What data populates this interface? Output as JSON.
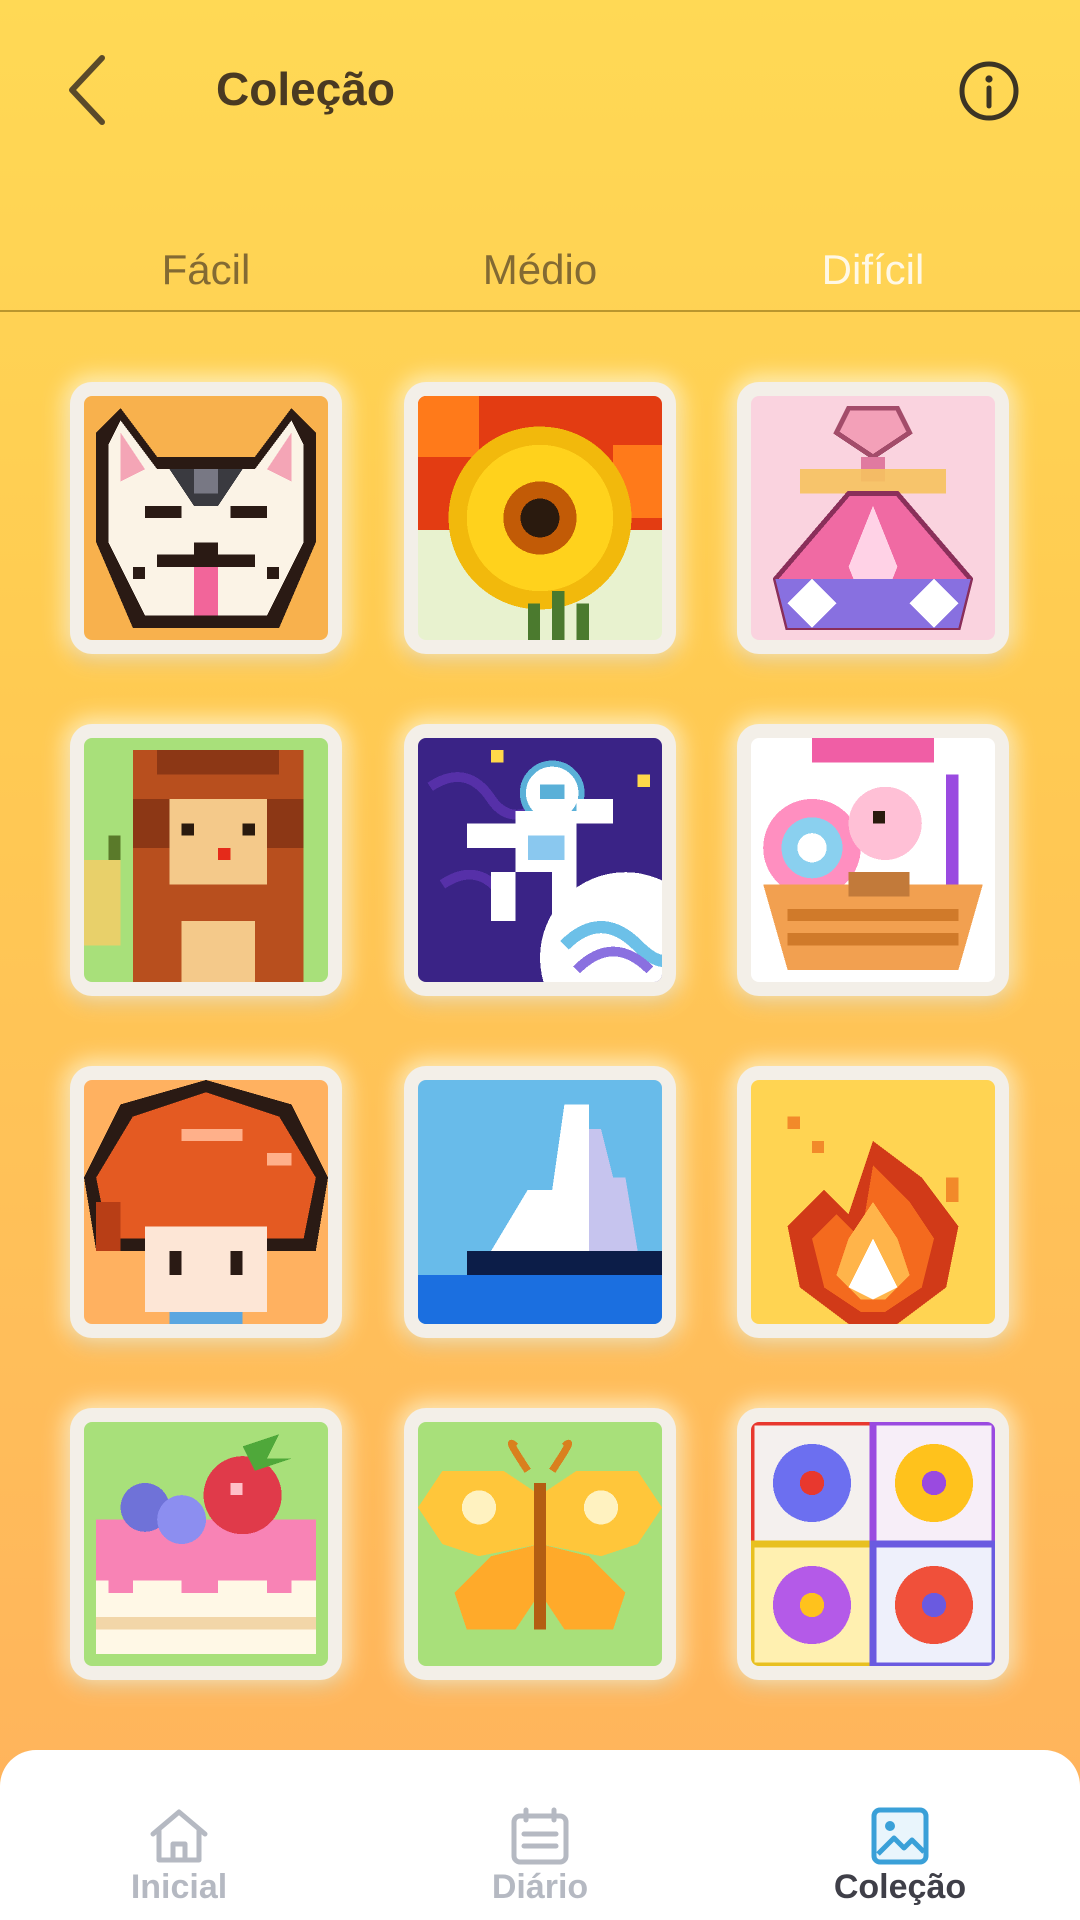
{
  "header": {
    "title": "Coleção",
    "back_icon": "chevron-left-icon",
    "info_icon": "info-icon"
  },
  "tabs": [
    {
      "label": "Fácil",
      "active": false
    },
    {
      "label": "Médio",
      "active": false
    },
    {
      "label": "Difícil",
      "active": true
    }
  ],
  "collection": [
    {
      "name": "bulldog-pixel-art"
    },
    {
      "name": "sunflower-pixel-art"
    },
    {
      "name": "perfume-bottle-pixel-art"
    },
    {
      "name": "monkey-pixel-art"
    },
    {
      "name": "astronaut-pixel-art"
    },
    {
      "name": "candy-basket-pixel-art"
    },
    {
      "name": "red-hair-boy-pixel-art"
    },
    {
      "name": "iceberg-pixel-art"
    },
    {
      "name": "fire-pixel-art"
    },
    {
      "name": "strawberry-cake-pixel-art"
    },
    {
      "name": "butterfly-pixel-art"
    },
    {
      "name": "flower-tiles-pixel-art"
    }
  ],
  "bottom_nav": [
    {
      "label": "Inicial",
      "icon": "home-icon",
      "active": false
    },
    {
      "label": "Diário",
      "icon": "calendar-icon",
      "active": false
    },
    {
      "label": "Coleção",
      "icon": "gallery-icon",
      "active": true
    }
  ],
  "colors": {
    "background_top": "#ffd955",
    "background_bottom": "#ffb15c",
    "active_tab": "#fff8e6",
    "inactive_tab": "#836a33",
    "nav_active": "#3f3f48",
    "nav_inactive": "#b5b9c2",
    "active_icon": "#3aa0d8"
  }
}
